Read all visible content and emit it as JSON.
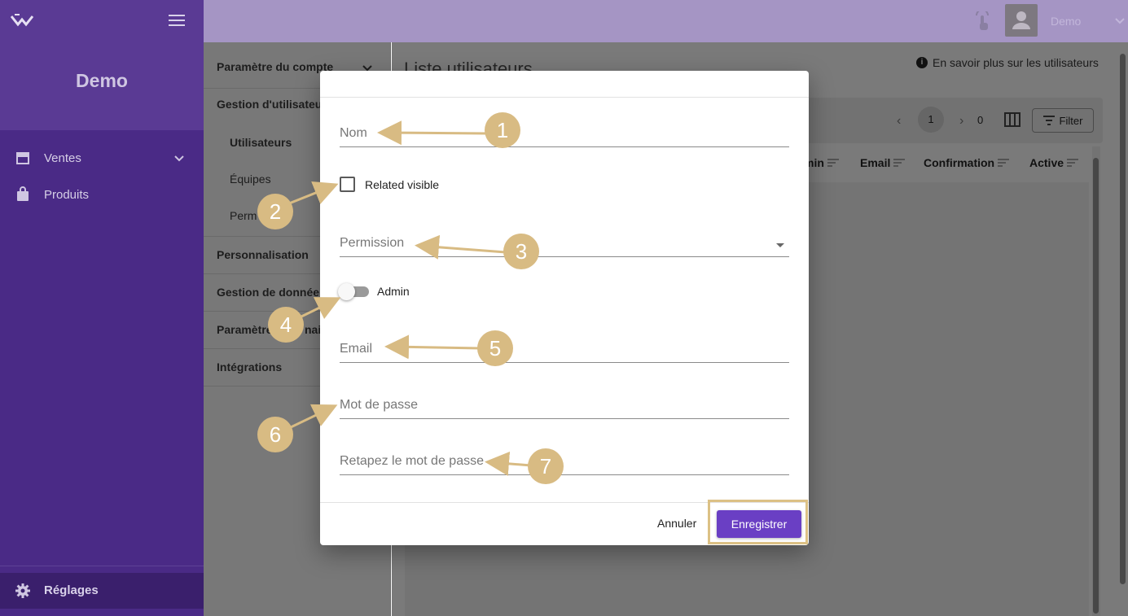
{
  "brand": {
    "name": "Demo",
    "logo_icon": "logo-icon",
    "menu_icon": "hamburger-icon"
  },
  "sidebar": {
    "items": [
      {
        "label": "Ventes",
        "icon": "store-icon"
      },
      {
        "label": "Produits",
        "icon": "bag-icon"
      }
    ],
    "settings": {
      "label": "Réglages",
      "icon": "gear-icon"
    }
  },
  "topbar": {
    "user_name": "Demo"
  },
  "submenu": {
    "account": "Paramètre du compte",
    "users_management": "Gestion d'utilisateur",
    "users": "Utilisateurs",
    "teams": "Équipes",
    "permissions": "Perm",
    "personalization": "Personnalisation",
    "data_management": "Gestion de donnée",
    "domain_settings_start": "Paramètre",
    "domain_settings_end": "nai",
    "integrations": "Intégrations"
  },
  "main": {
    "title": "Liste utilisateurs",
    "learn_more": "En savoir plus sur les utilisateurs",
    "pager": {
      "page": "1",
      "count": "0"
    },
    "filter_label": "Filter",
    "columns": [
      "min",
      "Email",
      "Confirmation",
      "Active"
    ]
  },
  "modal": {
    "name_placeholder": "Nom",
    "related_visible_label": "Related visible",
    "permission_placeholder": "Permission",
    "admin_label": "Admin",
    "admin_enabled": false,
    "email_placeholder": "Email",
    "password_placeholder": "Mot de passe",
    "password_confirm_placeholder": "Retapez le mot de passe",
    "cancel_label": "Annuler",
    "save_label": "Enregistrer"
  },
  "callouts": [
    "1",
    "2",
    "3",
    "4",
    "5",
    "6",
    "7"
  ],
  "colors": {
    "sidebar": "#4a2a86",
    "primary_button": "#6a3fc4",
    "callout": "#d8bb83",
    "topbar": "#a595c4"
  }
}
